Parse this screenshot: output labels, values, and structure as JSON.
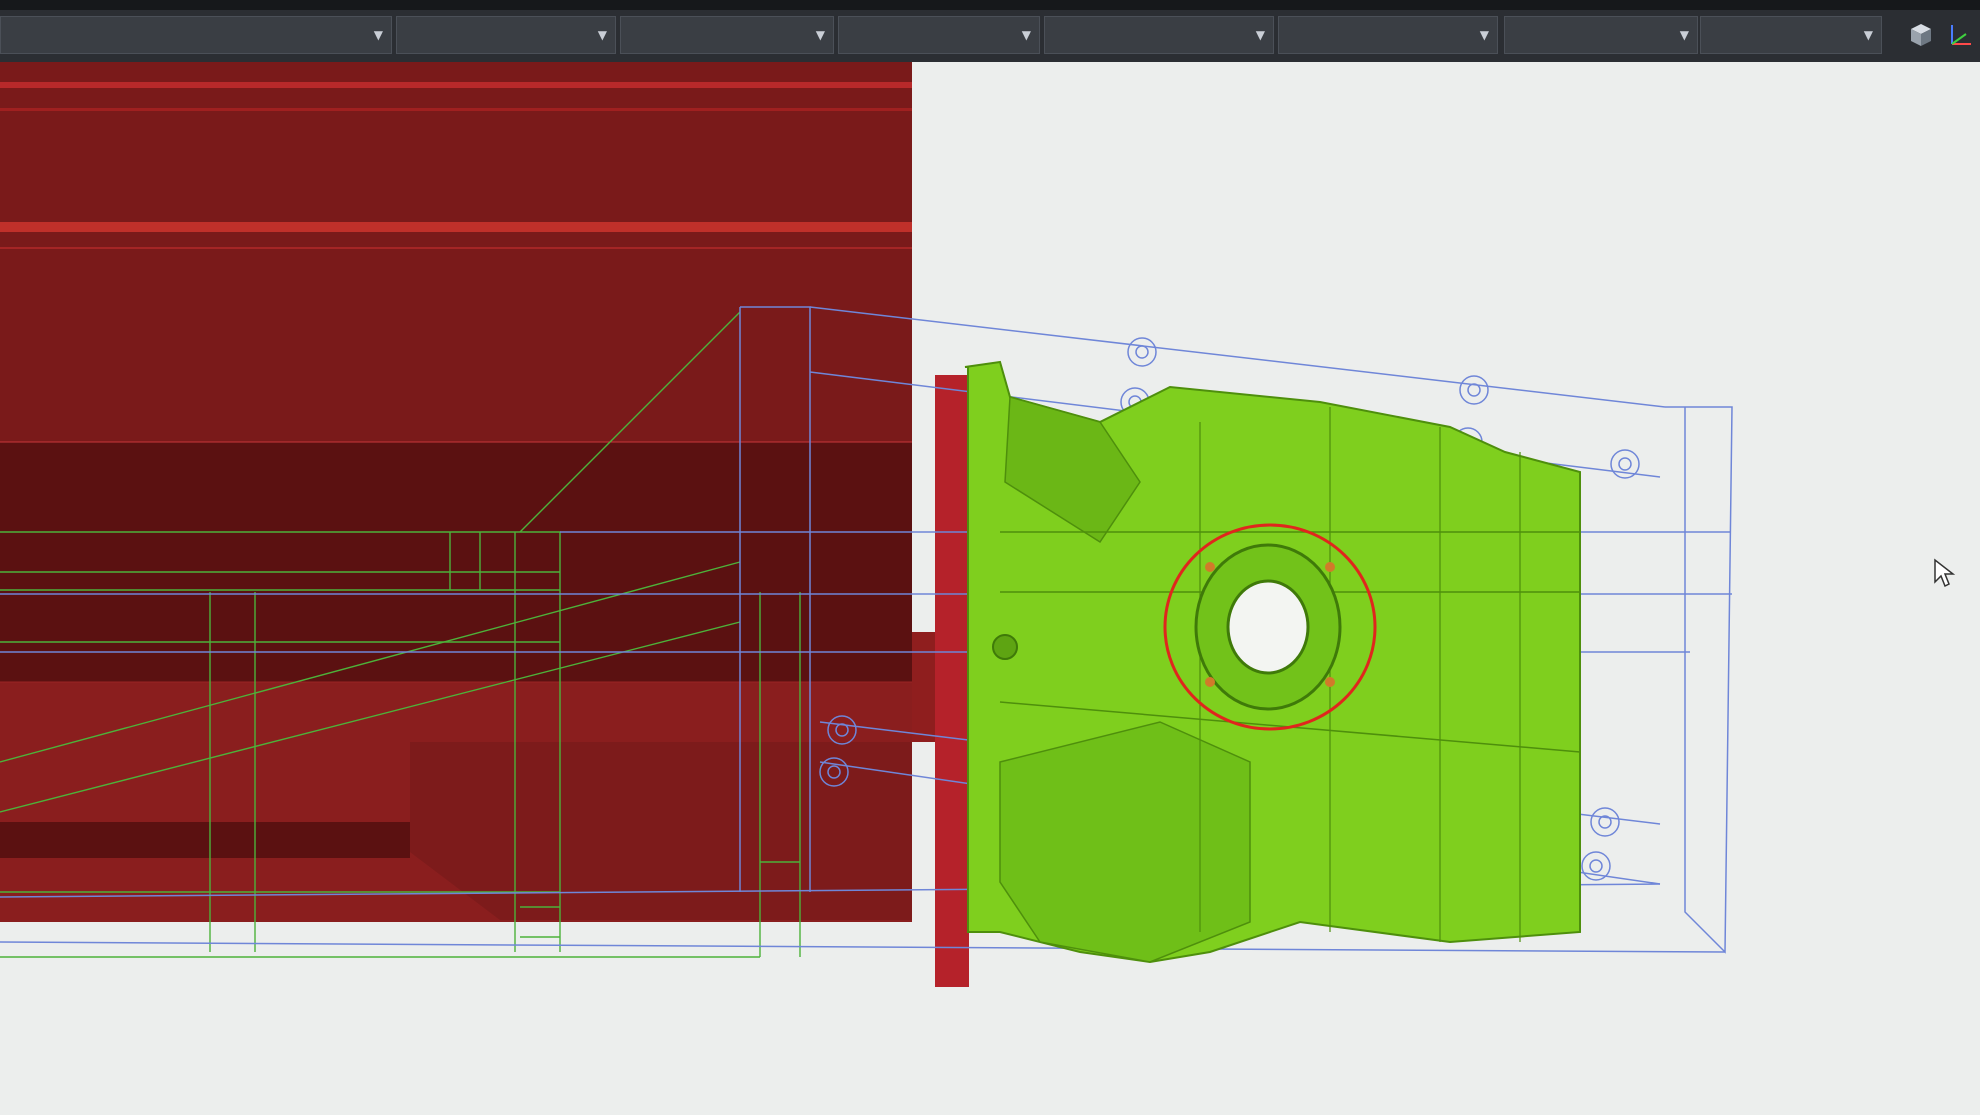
{
  "colors": {
    "toolbar_bg": "#2b2e33",
    "viewport_bg": "#eceeed",
    "body_red": "#7a1a1a",
    "body_red_dark": "#5a1010",
    "housing_green": "#7fcf1e",
    "wire_blue": "#6f86d8",
    "wire_green": "#4db23a",
    "seal_red": "#e0261d"
  },
  "toolbar": {
    "dropdowns": [
      {
        "name": "dropdown-1",
        "value": ""
      },
      {
        "name": "dropdown-2",
        "value": ""
      },
      {
        "name": "dropdown-3",
        "value": ""
      },
      {
        "name": "dropdown-4",
        "value": ""
      },
      {
        "name": "dropdown-5",
        "value": ""
      },
      {
        "name": "dropdown-6",
        "value": ""
      },
      {
        "name": "dropdown-7",
        "value": ""
      },
      {
        "name": "dropdown-8",
        "value": ""
      }
    ],
    "icons": [
      "view-cube-icon",
      "axis-triad-icon"
    ]
  },
  "viewport": {
    "objects": [
      "engine-block",
      "transmission-housing",
      "bounding-wireframe",
      "flywheel-plate",
      "seal-ring"
    ]
  }
}
